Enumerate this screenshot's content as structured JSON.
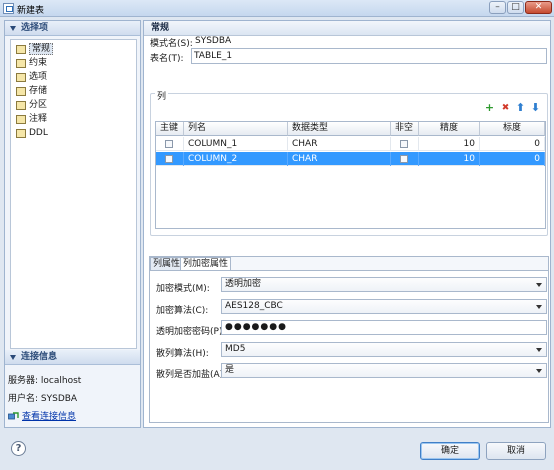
{
  "window": {
    "title": "新建表",
    "controls": {
      "minimize": "–",
      "maximize": "□",
      "close": "✕"
    }
  },
  "left": {
    "options_header": "选择项",
    "nav_items": [
      {
        "label": "常规",
        "selected": true
      },
      {
        "label": "约束"
      },
      {
        "label": "选项"
      },
      {
        "label": "存储"
      },
      {
        "label": "分区"
      },
      {
        "label": "注释"
      },
      {
        "label": "DDL"
      }
    ],
    "conn_header": "连接信息",
    "server_line": "服务器: localhost",
    "user_line": "用户名: SYSDBA",
    "view_conn_link": "查看连接信息"
  },
  "main": {
    "section_title": "常规",
    "schema_label": "模式名(S):",
    "schema_value": "SYSDBA",
    "table_label": "表名(T):",
    "table_value": "TABLE_1",
    "columns_legend": "列",
    "toolbar": {
      "add": "+",
      "delete": "✖",
      "up": "⬆",
      "down": "⬇"
    },
    "grid": {
      "headers": [
        "主键",
        "列名",
        "数据类型",
        "非空",
        "精度",
        "标度"
      ],
      "rows": [
        {
          "name": "COLUMN_1",
          "type": "CHAR",
          "precision": "10",
          "scale": "0",
          "selected": false
        },
        {
          "name": "COLUMN_2",
          "type": "CHAR",
          "precision": "10",
          "scale": "0",
          "selected": true
        }
      ]
    },
    "tabs": [
      "列属性",
      "列加密属性"
    ],
    "active_tab": "列加密属性",
    "encryption": {
      "mode_label": "加密模式(M):",
      "mode_value": "透明加密",
      "algorithm_label": "加密算法(C):",
      "algorithm_value": "AES128_CBC",
      "password_label": "透明加密密码(P):",
      "password_value": "●●●●●●●",
      "hash_label": "散列算法(H):",
      "hash_value": "MD5",
      "salt_label": "散列是否加盐(A):",
      "salt_value": "是"
    }
  },
  "footer": {
    "help": "?",
    "ok_label": "确定",
    "cancel_label": "取消"
  },
  "colors": {
    "selection": "#3399ff",
    "add": "#2e9a2e",
    "delete": "#d23a2a",
    "arrows": "#2f7fd0",
    "link": "#0033aa"
  }
}
